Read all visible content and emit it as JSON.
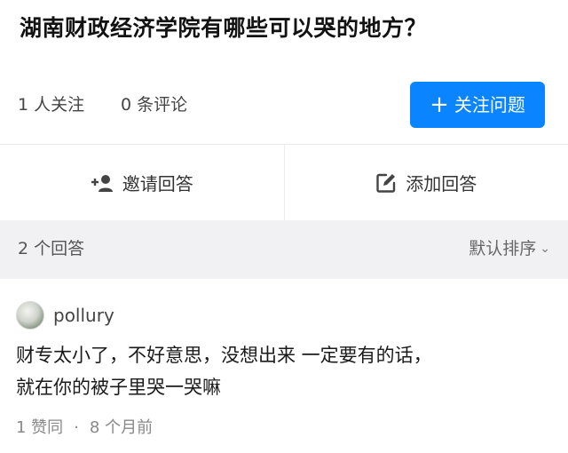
{
  "question": {
    "title": "湖南财政经济学院有哪些可以哭的地方？"
  },
  "meta": {
    "followers": "1 人关注",
    "comments": "0 条评论",
    "follow_button": "关注问题",
    "follow_button_icon": "plus-icon"
  },
  "actions": {
    "invite_label": "邀请回答",
    "invite_icon": "invite-user-icon",
    "write_label": "添加回答",
    "write_icon": "edit-icon"
  },
  "answers_header": {
    "count": "2 个回答",
    "sort_label": "默认排序",
    "sort_icon": "chevron-down-icon"
  },
  "answers": [
    {
      "author": "pollury",
      "lines": [
        "财专太小了，不好意思，没想出来 一定要有的话，",
        "就在你的被子里哭一哭嘛"
      ],
      "votes": "1 赞同",
      "time": "8 个月前"
    }
  ],
  "colors": {
    "accent": "#0a84ff",
    "bar_bg": "#f1f1f3"
  }
}
